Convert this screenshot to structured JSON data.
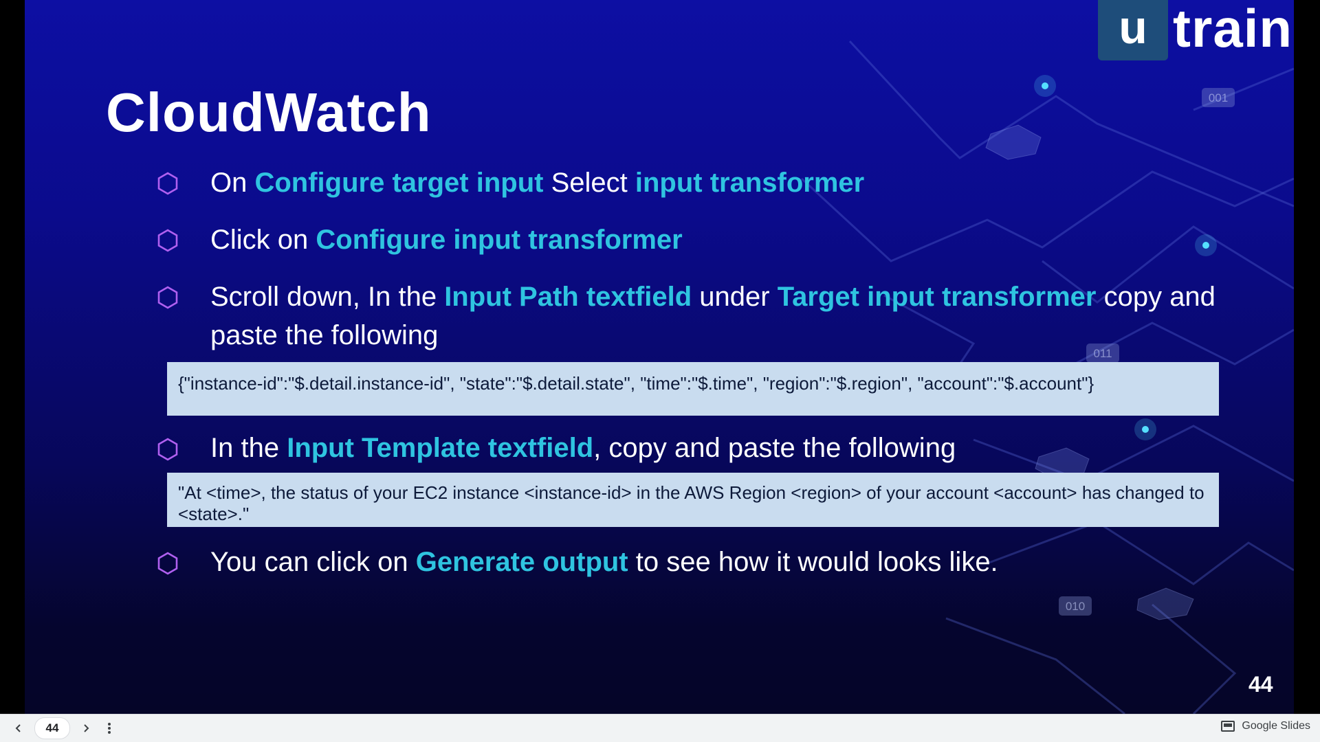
{
  "slide": {
    "logo": {
      "mark": "u",
      "name": "train"
    },
    "title": "CloudWatch",
    "bullets": [
      {
        "parts": [
          {
            "text": "On ",
            "hl": false
          },
          {
            "text": "Configure target input",
            "hl": true
          },
          {
            "text": " Select ",
            "hl": false
          },
          {
            "text": "input transformer",
            "hl": true
          }
        ]
      },
      {
        "parts": [
          {
            "text": "Click on ",
            "hl": false
          },
          {
            "text": "Configure input transformer",
            "hl": true
          }
        ]
      },
      {
        "parts": [
          {
            "text": "Scroll down, In the ",
            "hl": false
          },
          {
            "text": "Input Path textfield",
            "hl": true
          },
          {
            "text": " under ",
            "hl": false
          },
          {
            "text": "Target input transformer",
            "hl": true
          },
          {
            "text": " copy and paste the following",
            "hl": false
          }
        ]
      },
      {
        "parts": [
          {
            "text": "In the  ",
            "hl": false
          },
          {
            "text": "Input Template textfield",
            "hl": true
          },
          {
            "text": ", copy and paste the following",
            "hl": false
          }
        ]
      },
      {
        "parts": [
          {
            "text": "You can click on ",
            "hl": false
          },
          {
            "text": "Generate output",
            "hl": true
          },
          {
            "text": " to see how it would looks like.",
            "hl": false
          }
        ]
      }
    ],
    "code_input_path": "{\"instance-id\":\"$.detail.instance-id\", \"state\":\"$.detail.state\", \"time\":\"$.time\", \"region\":\"$.region\", \"account\":\"$.account\"}",
    "code_input_template": "\"At <time>, the status of your EC2 instance <instance-id> in the AWS Region <region> of your account <account> has changed to <state>.\"",
    "deco_labels": [
      "001",
      "011",
      "010"
    ],
    "page_number": "44",
    "colors": {
      "highlight": "#2fc4e0",
      "bullet_icon": "#b060f0",
      "code_bg": "#c9dcef"
    }
  },
  "viewer": {
    "prev_icon": "chevron-left-icon",
    "current_page": "44",
    "next_icon": "chevron-right-icon",
    "menu_icon": "more-vert-icon",
    "brand_icon": "slides-icon",
    "brand": "Google Slides"
  }
}
